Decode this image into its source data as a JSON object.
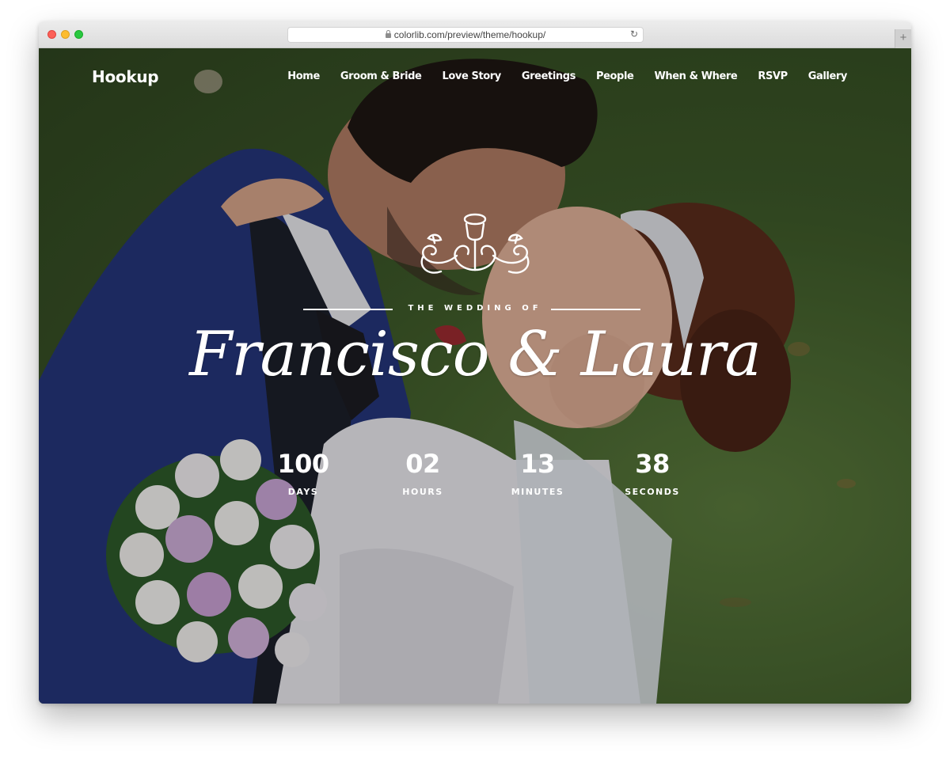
{
  "browser": {
    "url": "colorlib.com/preview/theme/hookup/",
    "reload_glyph": "↻",
    "new_tab_glyph": "+"
  },
  "site": {
    "logo": "Hookup",
    "nav": [
      "Home",
      "Groom & Bride",
      "Love Story",
      "Greetings",
      "People",
      "When & Where",
      "RSVP",
      "Gallery"
    ]
  },
  "hero": {
    "kicker": "THE WEDDING OF",
    "names": "Francisco & Laura",
    "countdown": [
      {
        "value": "100",
        "label": "DAYS"
      },
      {
        "value": "02",
        "label": "HOURS"
      },
      {
        "value": "13",
        "label": "MINUTES"
      },
      {
        "value": "38",
        "label": "SECONDS"
      }
    ]
  },
  "colors": {
    "grass": "#3e5a29",
    "suit": "#24357a",
    "dress": "#e9e8ee",
    "hair": "#5a2c1c",
    "text": "#ffffff"
  }
}
